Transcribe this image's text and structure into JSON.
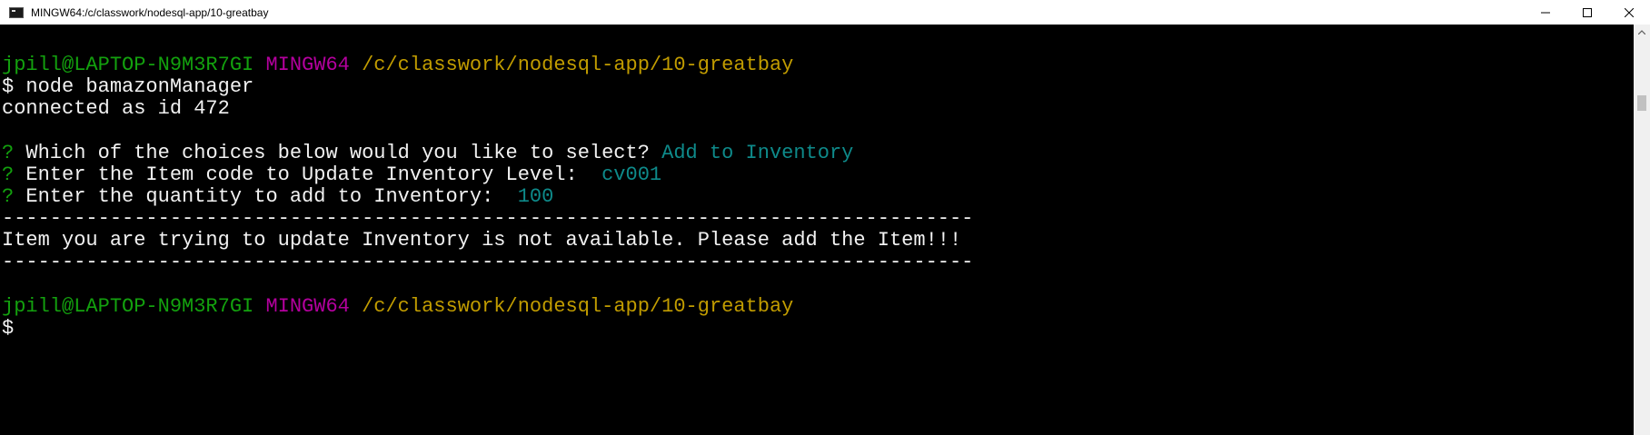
{
  "window": {
    "title": "MINGW64:/c/classwork/nodesql-app/10-greatbay",
    "icon": "terminal-icon"
  },
  "controls": {
    "minimize": "minimize-icon",
    "maximize": "maximize-icon",
    "close": "close-icon"
  },
  "terminal": {
    "prompt1": {
      "user_host": "jpill@LAPTOP-N9M3R7GI",
      "env": "MINGW64",
      "path": "/c/classwork/nodesql-app/10-greatbay"
    },
    "command": "$ node bamazonManager",
    "connected": "connected as id 472",
    "q1": {
      "mark": "?",
      "question": " Which of the choices below would you like to select? ",
      "answer": "Add to Inventory"
    },
    "q2": {
      "mark": "?",
      "question": " Enter the Item code to Update Inventory Level:  ",
      "answer": "cv001"
    },
    "q3": {
      "mark": "?",
      "question": " Enter the quantity to add to Inventory:  ",
      "answer": "100"
    },
    "divider": "---------------------------------------------------------------------------------",
    "message": "Item you are trying to update Inventory is not available. Please add the Item!!!",
    "prompt2": {
      "user_host": "jpill@LAPTOP-N9M3R7GI",
      "env": "MINGW64",
      "path": "/c/classwork/nodesql-app/10-greatbay"
    },
    "cursor_prompt": "$"
  },
  "colors": {
    "background": "#000000",
    "text": "#f2f2f2",
    "user_host": "#13a10e",
    "env": "#b4009e",
    "path": "#c19c00",
    "answer": "#0e8a8a"
  }
}
